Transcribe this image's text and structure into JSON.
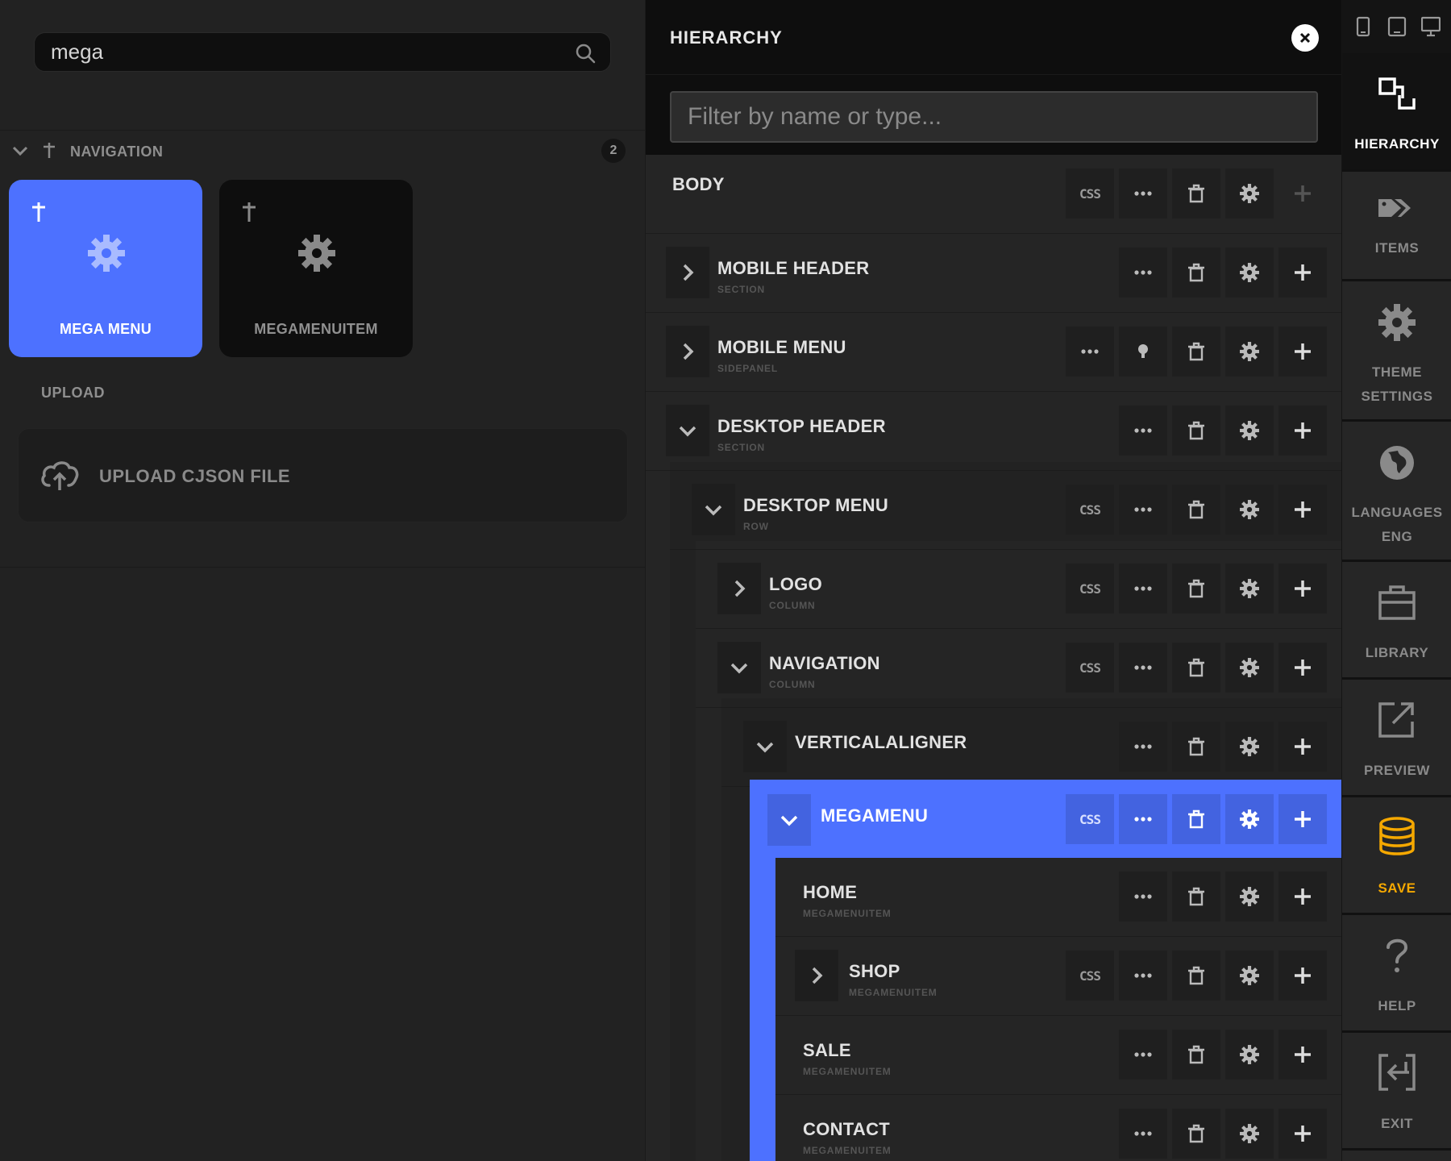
{
  "search": {
    "value": "mega"
  },
  "navigation_group": {
    "label": "NAVIGATION",
    "count": "2"
  },
  "tiles": [
    {
      "label": "MEGA MENU"
    },
    {
      "label": "MEGAMENUITEM"
    }
  ],
  "upload": {
    "section_label": "UPLOAD",
    "button_label": "UPLOAD CJSON FILE"
  },
  "hierarchy": {
    "title": "HIERARCHY",
    "filter_placeholder": "Filter by name or type...",
    "css_label": "CSS",
    "rows": [
      {
        "name": "BODY",
        "type": ""
      },
      {
        "name": "MOBILE HEADER",
        "type": "SECTION"
      },
      {
        "name": "MOBILE MENU",
        "type": "SIDEPANEL"
      },
      {
        "name": "DESKTOP HEADER",
        "type": "SECTION"
      },
      {
        "name": "DESKTOP MENU",
        "type": "ROW"
      },
      {
        "name": "LOGO",
        "type": "COLUMN"
      },
      {
        "name": "NAVIGATION",
        "type": "COLUMN"
      },
      {
        "name": "VERTICALALIGNER",
        "type": ""
      },
      {
        "name": "MEGAMENU",
        "type": ""
      },
      {
        "name": "HOME",
        "type": "MEGAMENUITEM"
      },
      {
        "name": "SHOP",
        "type": "MEGAMENUITEM"
      },
      {
        "name": "SALE",
        "type": "MEGAMENUITEM"
      },
      {
        "name": "CONTACT",
        "type": "MEGAMENUITEM"
      }
    ]
  },
  "rail": {
    "hierarchy": "HIERARCHY",
    "items": "ITEMS",
    "theme_1": "THEME",
    "theme_2": "SETTINGS",
    "languages": "LANGUAGES",
    "language_code": "ENG",
    "library": "LIBRARY",
    "preview": "PREVIEW",
    "save": "SAVE",
    "help": "HELP",
    "exit": "EXIT"
  },
  "colors": {
    "accent": "#4d71ff",
    "save": "#f5a800",
    "background": "#222222"
  }
}
